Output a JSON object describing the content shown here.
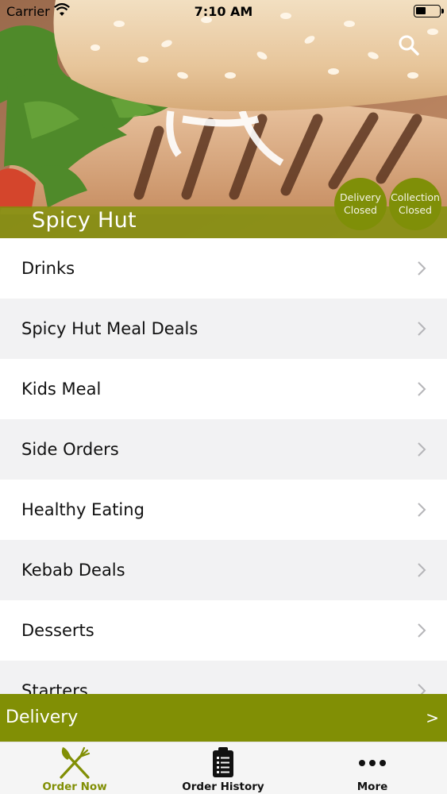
{
  "status_bar": {
    "carrier": "Carrier",
    "time": "7:10 AM"
  },
  "header": {
    "restaurant_name": "Spicy Hut",
    "search_icon": "search-icon",
    "delivery_status": {
      "line1": "Delivery",
      "line2": "Closed"
    },
    "collection_status": {
      "line1": "Collection",
      "line2": "Closed"
    },
    "accent_color": "#818f05"
  },
  "menu": {
    "categories": [
      {
        "label": "Drinks"
      },
      {
        "label": "Spicy Hut Meal Deals"
      },
      {
        "label": "Kids Meal"
      },
      {
        "label": "Side Orders"
      },
      {
        "label": "Healthy Eating"
      },
      {
        "label": "Kebab Deals"
      },
      {
        "label": "Desserts"
      },
      {
        "label": "Starters"
      }
    ]
  },
  "order_type_bar": {
    "label": "Delivery",
    "arrow": ">"
  },
  "tab_bar": {
    "tabs": [
      {
        "label": "Order Now",
        "icon": "fork-knife-icon",
        "active": true
      },
      {
        "label": "Order History",
        "icon": "clipboard-list-icon",
        "active": false
      },
      {
        "label": "More",
        "icon": "more-dots-icon",
        "active": false
      }
    ]
  }
}
